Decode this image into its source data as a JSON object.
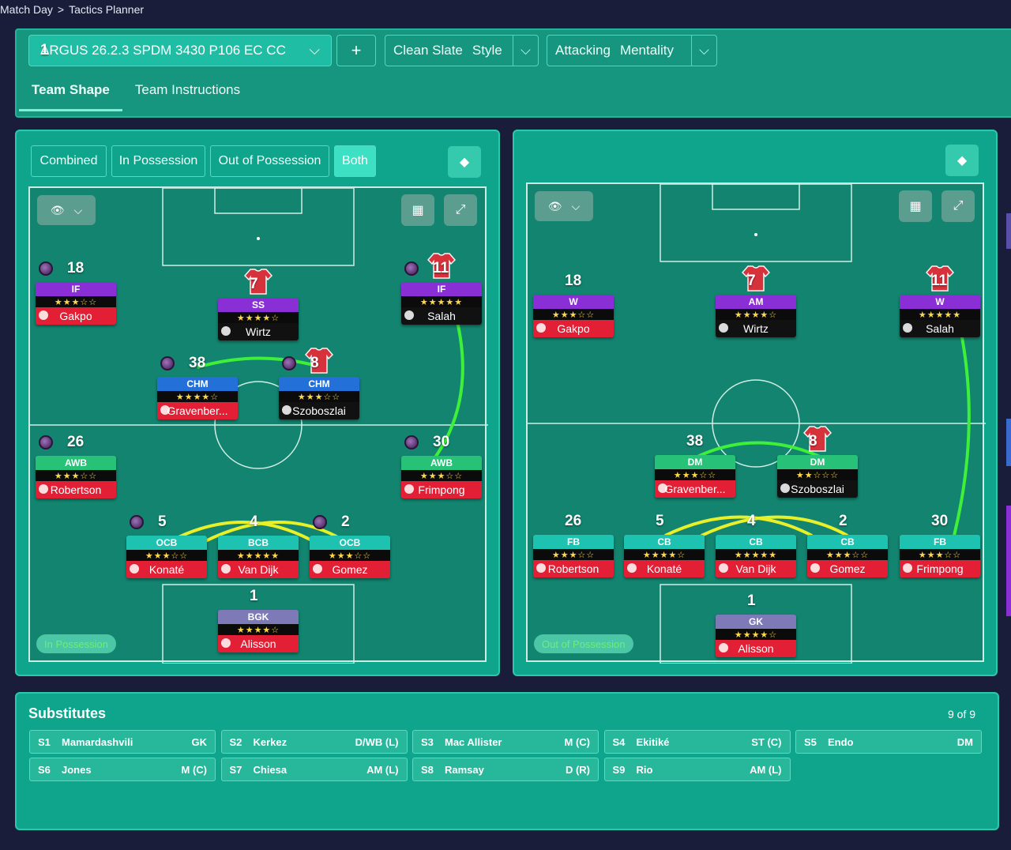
{
  "breadcrumb": {
    "first": "Match Day",
    "sep": ">",
    "second": "Tactics Planner"
  },
  "tactic": {
    "number": "1",
    "name": "ARGUS 26.2.3 SPDM 3430 P106 EC CC",
    "add": "+"
  },
  "style": {
    "value": "Clean Slate",
    "label": "Style"
  },
  "mentality": {
    "value": "Attacking",
    "label": "Mentality"
  },
  "tabs": [
    "Team Shape",
    "Team Instructions"
  ],
  "phase_tabs": [
    "Combined",
    "In Possession",
    "Out of Possession",
    "Both"
  ],
  "left_pitch": {
    "phase": "In Possession",
    "players": [
      {
        "num": "18",
        "role": "IF",
        "stars": "★★★☆☆",
        "name": "Gakpo"
      },
      {
        "num": "7",
        "role": "SS",
        "stars": "★★★★☆",
        "name": "Wirtz"
      },
      {
        "num": "11",
        "role": "IF",
        "stars": "★★★★★",
        "name": "Salah"
      },
      {
        "num": "38",
        "role": "CHM",
        "stars": "★★★★☆",
        "name": "Gravenber..."
      },
      {
        "num": "8",
        "role": "CHM",
        "stars": "★★★☆☆",
        "name": "Szoboszlai"
      },
      {
        "num": "26",
        "role": "AWB",
        "stars": "★★★☆☆",
        "name": "Robertson"
      },
      {
        "num": "30",
        "role": "AWB",
        "stars": "★★★☆☆",
        "name": "Frimpong"
      },
      {
        "num": "5",
        "role": "OCB",
        "stars": "★★★☆☆",
        "name": "Konaté"
      },
      {
        "num": "4",
        "role": "BCB",
        "stars": "★★★★★",
        "name": "Van Dijk"
      },
      {
        "num": "2",
        "role": "OCB",
        "stars": "★★★☆☆",
        "name": "Gomez"
      },
      {
        "num": "1",
        "role": "BGK",
        "stars": "★★★★☆",
        "name": "Alisson"
      }
    ]
  },
  "right_pitch": {
    "phase": "Out of Possession",
    "players": [
      {
        "num": "18",
        "role": "W",
        "stars": "★★★☆☆",
        "name": "Gakpo"
      },
      {
        "num": "7",
        "role": "AM",
        "stars": "★★★★☆",
        "name": "Wirtz"
      },
      {
        "num": "11",
        "role": "W",
        "stars": "★★★★★",
        "name": "Salah"
      },
      {
        "num": "38",
        "role": "DM",
        "stars": "★★★☆☆",
        "name": "Gravenber..."
      },
      {
        "num": "8",
        "role": "DM",
        "stars": "★★☆☆☆",
        "name": "Szoboszlai"
      },
      {
        "num": "26",
        "role": "FB",
        "stars": "★★★☆☆",
        "name": "Robertson"
      },
      {
        "num": "5",
        "role": "CB",
        "stars": "★★★★☆",
        "name": "Konaté"
      },
      {
        "num": "4",
        "role": "CB",
        "stars": "★★★★★",
        "name": "Van Dijk"
      },
      {
        "num": "2",
        "role": "CB",
        "stars": "★★★☆☆",
        "name": "Gomez"
      },
      {
        "num": "30",
        "role": "FB",
        "stars": "★★★☆☆",
        "name": "Frimpong"
      },
      {
        "num": "1",
        "role": "GK",
        "stars": "★★★★☆",
        "name": "Alisson"
      }
    ]
  },
  "substitutes": {
    "title": "Substitutes",
    "count": "9 of 9",
    "list": [
      {
        "slot": "S1",
        "name": "Mamardashvili",
        "pos": "GK"
      },
      {
        "slot": "S2",
        "name": "Kerkez",
        "pos": "D/WB (L)"
      },
      {
        "slot": "S3",
        "name": "Mac Allister",
        "pos": "M (C)"
      },
      {
        "slot": "S4",
        "name": "Ekitiké",
        "pos": "ST (C)"
      },
      {
        "slot": "S5",
        "name": "Endo",
        "pos": "DM"
      },
      {
        "slot": "S6",
        "name": "Jones",
        "pos": "M (C)"
      },
      {
        "slot": "S7",
        "name": "Chiesa",
        "pos": "AM (L)"
      },
      {
        "slot": "S8",
        "name": "Ramsay",
        "pos": "D (R)"
      },
      {
        "slot": "S9",
        "name": "Rio",
        "pos": "AM (L)"
      }
    ]
  }
}
